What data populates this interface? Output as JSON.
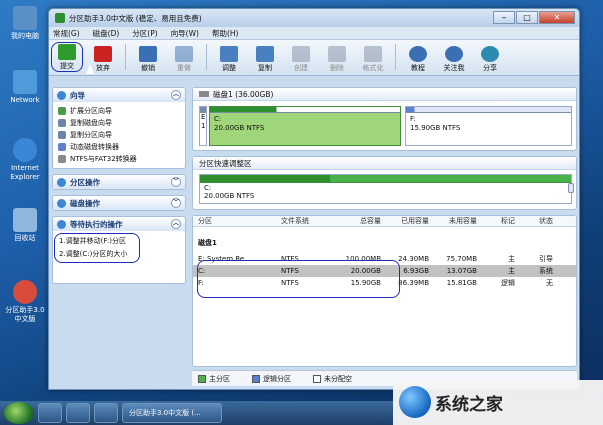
{
  "desktop": {
    "icons": [
      {
        "label": "我的电脑",
        "color": "#5a8fc8"
      },
      {
        "label": "Network",
        "color": "#4f9ad8"
      },
      {
        "label": "Internet Explorer",
        "color": "#3b86d6"
      },
      {
        "label": "回收站",
        "color": "#8fb7dd"
      },
      {
        "label": "分区助手3.0中文版",
        "color": "#d94b3a"
      }
    ]
  },
  "window": {
    "title": "分区助手3.0中文版 (稳定、易用且免费)",
    "controls": {
      "minimize": "‒",
      "maximize": "□",
      "close": "✕"
    }
  },
  "menu": [
    "常规(G)",
    "磁盘(D)",
    "分区(P)",
    "向导(W)",
    "帮助(H)"
  ],
  "toolbar": {
    "items": [
      {
        "label": "提交",
        "icon": "check-icon",
        "color": "#2e9b2e",
        "enabled": true
      },
      {
        "label": "放弃",
        "icon": "x-icon",
        "color": "#cc2222",
        "enabled": true
      },
      {
        "label": "撤销",
        "icon": "undo-icon",
        "color": "#3b6fb3",
        "enabled": true
      },
      {
        "label": "重做",
        "icon": "redo-icon",
        "color": "#3b6fb3",
        "enabled": false
      },
      {
        "label": "调整",
        "icon": "resize-icon",
        "color": "#4a7fc0",
        "enabled": true
      },
      {
        "label": "复制",
        "icon": "copy-icon",
        "color": "#4a7fc0",
        "enabled": true
      },
      {
        "label": "创建",
        "icon": "create-icon",
        "color": "#7f8fa3",
        "enabled": false
      },
      {
        "label": "删除",
        "icon": "delete-icon",
        "color": "#7f8fa3",
        "enabled": false
      },
      {
        "label": "格式化",
        "icon": "format-icon",
        "color": "#7f8fa3",
        "enabled": false
      },
      {
        "label": "教程",
        "icon": "help-icon",
        "color": "#3b6fb3",
        "enabled": true
      },
      {
        "label": "关注我",
        "icon": "user-icon",
        "color": "#3b6fb3",
        "enabled": true
      },
      {
        "label": "分享",
        "icon": "share-icon",
        "color": "#2e8bb0",
        "enabled": true
      }
    ]
  },
  "sidebar": {
    "wizard": {
      "title": "向导",
      "items": [
        "扩展分区向导",
        "复制磁盘向导",
        "复制分区向导",
        "动态磁盘转换器",
        "NTFS与FAT32转换器"
      ]
    },
    "partition_ops": "分区操作",
    "disk_ops": "磁盘操作",
    "pending": {
      "title": "等待执行的操作",
      "items": [
        "1.调整并移动(F:)分区",
        "2.调整(C:)分区的大小"
      ]
    }
  },
  "disk_map": {
    "header": "磁盘1 (36.00GB)",
    "blocks": [
      {
        "letter": "E",
        "sub": "1",
        "name": "",
        "info": "",
        "fill": 0.3,
        "color": "#7a8da8"
      },
      {
        "letter": "C:",
        "info": "20.00GB NTFS",
        "fill": 0.35,
        "color": "#49b249"
      },
      {
        "letter": "F:",
        "info": "15.90GB NTFS",
        "fill": 0.05,
        "color": "#5c7fd1"
      }
    ]
  },
  "quick_adjust": {
    "header": "分区快速调整区",
    "letter": "C:",
    "info": "20.00GB NTFS",
    "fill": 0.35
  },
  "table": {
    "columns": [
      "分区",
      "文件系统",
      "总容量",
      "已用容量",
      "未用容量",
      "标记",
      "状态"
    ],
    "disk_label": "磁盘1",
    "rows": [
      {
        "partition": "E: System Re...",
        "fs": "NTFS",
        "total": "100.00MB",
        "used": "24.30MB",
        "free": "75.70MB",
        "flag": "主",
        "status": "引导",
        "selected": false
      },
      {
        "partition": "C:",
        "fs": "NTFS",
        "total": "20.00GB",
        "used": "6.93GB",
        "free": "13.07GB",
        "flag": "主",
        "status": "系统",
        "selected": true
      },
      {
        "partition": "F:",
        "fs": "NTFS",
        "total": "15.90GB",
        "used": "86.39MB",
        "free": "15.81GB",
        "flag": "逻辑",
        "status": "无",
        "selected": false
      }
    ]
  },
  "legend": [
    {
      "label": "主分区",
      "color": "#49b249"
    },
    {
      "label": "逻辑分区",
      "color": "#5c7fd1"
    },
    {
      "label": "未分配空",
      "color": "#ffffff"
    }
  ],
  "taskbar": {
    "items": [
      "分区助手3.0中文版 (..."
    ]
  },
  "watermark": "系统之家"
}
